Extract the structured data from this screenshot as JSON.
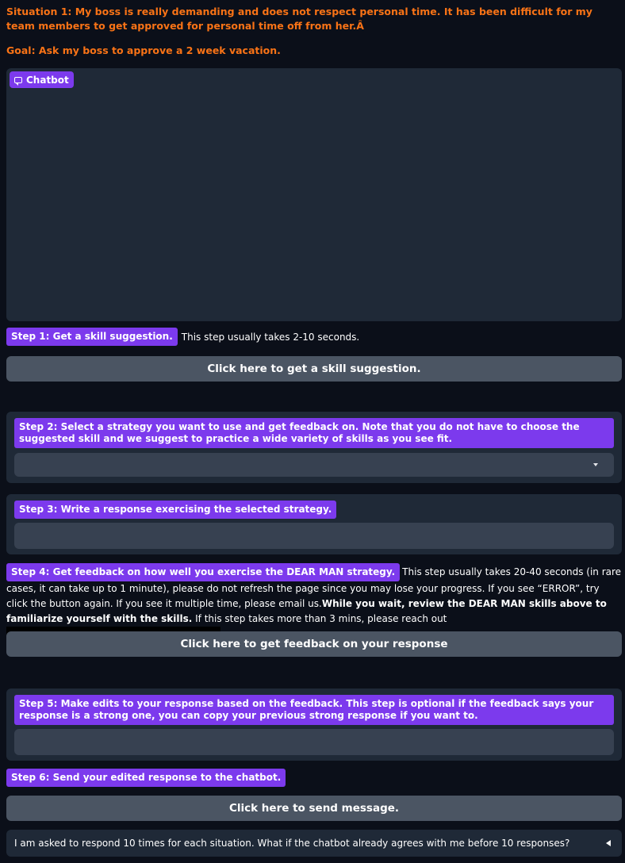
{
  "situation": "Situation 1: My boss is really demanding and does not respect personal time. It has been difficult for my team members to get approved for personal time off from her.Â",
  "goal": "Goal: Ask my boss to approve a 2 week vacation.",
  "chatbot": {
    "label": "Chatbot",
    "icon": "chat-bubble-icon"
  },
  "step1": {
    "label": "Step 1: Get a skill suggestion.",
    "note": "This step usually takes 2-10 seconds.",
    "button": "Click here to get a skill suggestion."
  },
  "step2": {
    "label": "Step 2: Select a strategy you want to use and get feedback on. Note that you do not have to choose the suggested skill and we suggest to practice a wide variety of skills as you see fit.",
    "selected_value": ""
  },
  "step3": {
    "label": "Step 3: Write a response exercising the selected strategy.",
    "value": ""
  },
  "step4": {
    "label": "Step 4: Get feedback on how well you exercise the DEAR MAN strategy.",
    "note_part1": "This step usually takes 20-40 seconds (in rare cases, it can take up to 1 minute), please do not refresh the page since you may lose your progress. If you see “ERROR”, try click the button again. If you see it multiple time, please email us.",
    "note_bold": "While you wait, review the DEAR MAN skills above to familiarize yourself with the skills.",
    "note_part2": " If this step takes more than 3 mins, please reach out",
    "button": "Click here to get feedback on your response"
  },
  "step5": {
    "label": "Step 5: Make edits to your response based on the feedback. This step is optional if the feedback says your response is a strong one, you can copy your previous strong response if you want to.",
    "value": ""
  },
  "step6": {
    "label": "Step 6: Send your edited response to the chatbot.",
    "button": "Click here to send message."
  },
  "faq": {
    "question": "I am asked to respond 10 times for each situation. What if the chatbot already agrees with me before 10 responses?"
  },
  "colors": {
    "accent": "#7c3aed",
    "heading": "#f97316",
    "background": "#0b0f19",
    "panel": "#1f2937",
    "button": "#4b5563"
  }
}
